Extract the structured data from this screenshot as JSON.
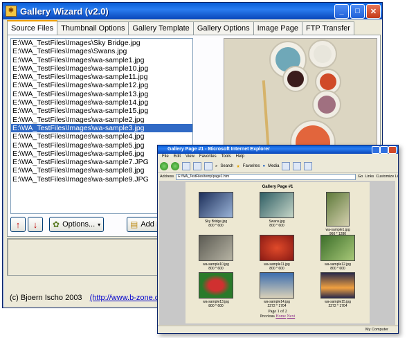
{
  "window": {
    "title": "Gallery Wizard (v2.0)"
  },
  "tabs": [
    "Source Files",
    "Thumbnail Options",
    "Gallery Template",
    "Gallery Options",
    "Image Page",
    "FTP Transfer"
  ],
  "files": [
    "E:\\WA_TestFiles\\Images\\Sky Bridge.jpg",
    "E:\\WA_TestFiles\\Images\\Swans.jpg",
    "E:\\WA_TestFiles\\Images\\wa-sample1.jpg",
    "E:\\WA_TestFiles\\Images\\wa-sample10.jpg",
    "E:\\WA_TestFiles\\Images\\wa-sample11.jpg",
    "E:\\WA_TestFiles\\Images\\wa-sample12.jpg",
    "E:\\WA_TestFiles\\Images\\wa-sample13.jpg",
    "E:\\WA_TestFiles\\Images\\wa-sample14.jpg",
    "E:\\WA_TestFiles\\Images\\wa-sample15.jpg",
    "E:\\WA_TestFiles\\Images\\wa-sample2.jpg",
    "E:\\WA_TestFiles\\Images\\wa-sample3.jpg",
    "E:\\WA_TestFiles\\Images\\wa-sample4.jpg",
    "E:\\WA_TestFiles\\Images\\wa-sample5.jpg",
    "E:\\WA_TestFiles\\Images\\wa-sample6.jpg",
    "E:\\WA_TestFiles\\Images\\wa-sample7.JPG",
    "E:\\WA_TestFiles\\Images\\wa-sample8.jpg",
    "E:\\WA_TestFiles\\Images\\wa-sample9.JPG"
  ],
  "selected_file": "E:\\WA_TestFiles\\Images\\wa-sample3.jpg",
  "buttons": {
    "options": "Options...",
    "add": "Add D"
  },
  "footer": {
    "credit": "(c) Bjoern Ischo 2003",
    "link": "(http://www.b-zone.de)"
  },
  "ie": {
    "title": "Gallery Page #1 - Microsoft Internet Explorer",
    "menu": [
      "File",
      "Edit",
      "View",
      "Favorites",
      "Tools",
      "Help"
    ],
    "toolbar": {
      "search": "Search",
      "favorites": "Favorites",
      "media": "Media"
    },
    "address_label": "Address",
    "address": "E:\\WA_TestFiles\\temp\\page1.htm",
    "go": "Go",
    "links": "Links",
    "customize": "Customize Li",
    "page_title": "Gallery Page #1",
    "thumbs": [
      {
        "name": "Sky Bridge.jpg",
        "size": "800 * 600",
        "c1": "#1d2f5a",
        "c2": "#9bb4d8"
      },
      {
        "name": "Swans.jpg",
        "size": "800 * 600",
        "c1": "#2f5e64",
        "c2": "#c6d6c8"
      },
      {
        "name": "wa-sample1.jpg",
        "size": "960 * 1280",
        "c1": "#5e7a3a",
        "c2": "#d4cfae"
      },
      {
        "name": "wa-sample10.jpg",
        "size": "800 * 600",
        "c1": "#5b5a52",
        "c2": "#b7b4a4"
      },
      {
        "name": "wa-sample11.jpg",
        "size": "800 * 600",
        "c1": "#8a1a14",
        "c2": "#e04a2a"
      },
      {
        "name": "wa-sample12.jpg",
        "size": "800 * 600",
        "c1": "#3c6e2a",
        "c2": "#a8c878"
      },
      {
        "name": "wa-sample13.jpg",
        "size": "800 * 600",
        "c1": "#2a7a2a",
        "c2": "#d03030"
      },
      {
        "name": "wa-sample14.jpg",
        "size": "2272 * 1704",
        "c1": "#3c6eae",
        "c2": "#d8d0b8"
      },
      {
        "name": "wa-sample15.jpg",
        "size": "2272 * 1704",
        "c1": "#2a2a4a",
        "c2": "#f0a040"
      }
    ],
    "page_nav": {
      "line1": "Page 1 of 2",
      "previous": "Previous",
      "home": "Home",
      "next": "Next"
    },
    "status": "My Computer"
  }
}
